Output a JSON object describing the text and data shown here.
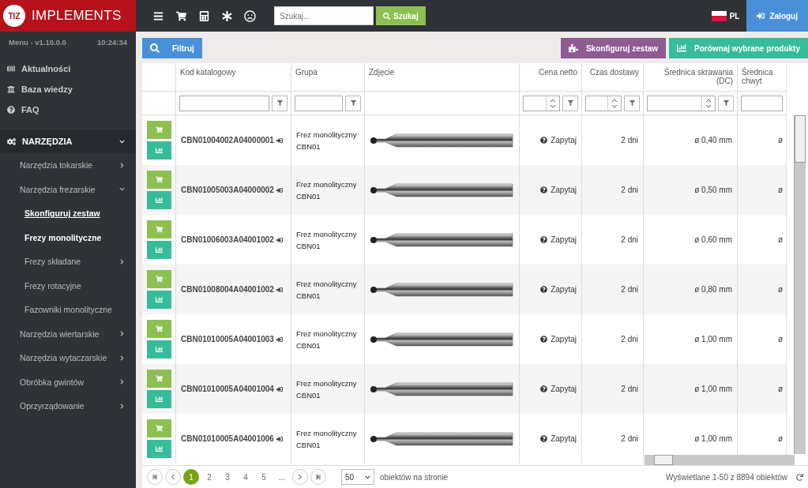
{
  "brand": {
    "logo_text": "TIZ",
    "name": "IMPLEMENTS"
  },
  "sidebar": {
    "version": "Menu - v1.10.0.0",
    "time": "10:24:34",
    "top_items": [
      {
        "kind": "news",
        "label": "Aktualności"
      },
      {
        "kind": "bank",
        "label": "Baza wiedzy"
      },
      {
        "kind": "help",
        "label": "FAQ"
      }
    ],
    "section": {
      "label": "NARZĘDZIA",
      "expanded": true,
      "children": [
        {
          "label": "Narzędzia tokarskie",
          "expanded": false
        },
        {
          "label": "Narzędzia frezarskie",
          "expanded": true,
          "children": [
            {
              "label": "Skonfiguruj zestaw",
              "kind": "link",
              "selected": false
            },
            {
              "label": "Frezy monolityczne",
              "kind": "item",
              "selected": true
            },
            {
              "label": "Frezy składane",
              "kind": "item",
              "selected": false,
              "expanded": false
            },
            {
              "label": "Frezy rotacyjne",
              "kind": "item",
              "selected": false
            },
            {
              "label": "Fazowniki monolityczne",
              "kind": "item",
              "selected": false
            }
          ]
        },
        {
          "label": "Narzędzia wiertarskie",
          "expanded": false
        },
        {
          "label": "Narzędzia wytaczarskie",
          "expanded": false
        },
        {
          "label": "Obróbka gwintów",
          "expanded": false
        },
        {
          "label": "Oprzyrządowanie",
          "expanded": false
        }
      ]
    }
  },
  "topbar": {
    "search_placeholder": "Szukaj...",
    "search_button": "Szukaj",
    "language": "PL",
    "login": "Zaloguj"
  },
  "toolbar": {
    "filter": "Filtruj",
    "configure": "Skonfiguruj zestaw",
    "compare": "Porównaj wybrane produkty"
  },
  "table": {
    "columns": [
      {
        "label": "Kod katalogowy",
        "kind": "text"
      },
      {
        "label": "Grupa",
        "kind": "text"
      },
      {
        "label": "Zdjęcie",
        "kind": "image"
      },
      {
        "label": "Cena netto",
        "kind": "number"
      },
      {
        "label": "Czas dostawy",
        "kind": "number"
      },
      {
        "label": "Średnica skrawania (DC)",
        "kind": "number"
      },
      {
        "label": "Średnica chwyt",
        "kind": "plain"
      }
    ],
    "rows": [
      {
        "code": "CBN01004002A04000001",
        "group": "Frez monolityczny CBN01",
        "price": "Zapytaj",
        "delivery": "2 dni",
        "dc": "ø 0,40 mm",
        "shank": "ø"
      },
      {
        "code": "CBN01005003A04000002",
        "group": "Frez monolityczny CBN01",
        "price": "Zapytaj",
        "delivery": "2 dni",
        "dc": "ø 0,50 mm",
        "shank": "ø"
      },
      {
        "code": "CBN01006003A04001002",
        "group": "Frez monolityczny CBN01",
        "price": "Zapytaj",
        "delivery": "2 dni",
        "dc": "ø 0,60 mm",
        "shank": "ø"
      },
      {
        "code": "CBN01008004A04001002",
        "group": "Frez monolityczny CBN01",
        "price": "Zapytaj",
        "delivery": "2 dni",
        "dc": "ø 0,80 mm",
        "shank": "ø"
      },
      {
        "code": "CBN01010005A04001003",
        "group": "Frez monolityczny CBN01",
        "price": "Zapytaj",
        "delivery": "2 dni",
        "dc": "ø 1,00 mm",
        "shank": "ø"
      },
      {
        "code": "CBN01010005A04001004",
        "group": "Frez monolityczny CBN01",
        "price": "Zapytaj",
        "delivery": "2 dni",
        "dc": "ø 1,00 mm",
        "shank": "ø"
      },
      {
        "code": "CBN01010005A04001006",
        "group": "Frez monolityczny CBN01",
        "price": "Zapytaj",
        "delivery": "2 dni",
        "dc": "ø 1,00 mm",
        "shank": "ø"
      }
    ]
  },
  "pagination": {
    "pages": [
      {
        "label": "1",
        "selected": true
      },
      {
        "label": "2",
        "selected": false
      },
      {
        "label": "3",
        "selected": false
      },
      {
        "label": "4",
        "selected": false
      },
      {
        "label": "5",
        "selected": false
      },
      {
        "label": "...",
        "selected": false
      }
    ],
    "page_size": "50",
    "page_size_label": "obiektów na stronie",
    "summary": "Wyświetlane 1-50 z 8894 obiektów"
  }
}
